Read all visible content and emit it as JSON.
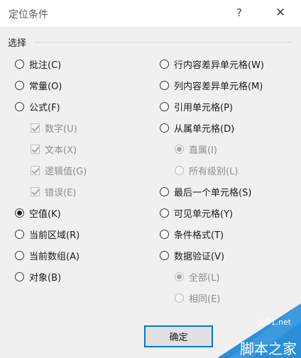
{
  "window": {
    "title": "定位条件",
    "help": "?",
    "close": "✕"
  },
  "group": {
    "label": "选择"
  },
  "options": {
    "comments": "批注(C)",
    "constants": "常量(O)",
    "formulas": "公式(F)",
    "numbers": "数字(U)",
    "text": "文本(X)",
    "logicals": "逻辑值(G)",
    "errors": "错误(E)",
    "blanks": "空值(K)",
    "current_region": "当前区域(R)",
    "current_array": "当前数组(A)",
    "objects": "对象(B)",
    "row_differences": "行内容差异单元格(W)",
    "column_differences": "列内容差异单元格(M)",
    "precedents": "引用单元格(P)",
    "dependents": "从属单元格(D)",
    "direct_only": "直属(I)",
    "all_levels": "所有级别(L)",
    "last_cell": "最后一个单元格(S)",
    "visible_cells": "可见单元格(Y)",
    "conditional_formats": "条件格式(T)",
    "data_validation": "数据验证(V)",
    "validation_all": "全部(L)",
    "validation_same": "相同(E)"
  },
  "selected_option": "空值(K)",
  "buttons": {
    "ok": "确定"
  },
  "watermark": {
    "site": "jb51.net",
    "name": "脚本之家"
  },
  "colors": {
    "accent": "#0078d7",
    "watermark": "#2b8fd8"
  }
}
